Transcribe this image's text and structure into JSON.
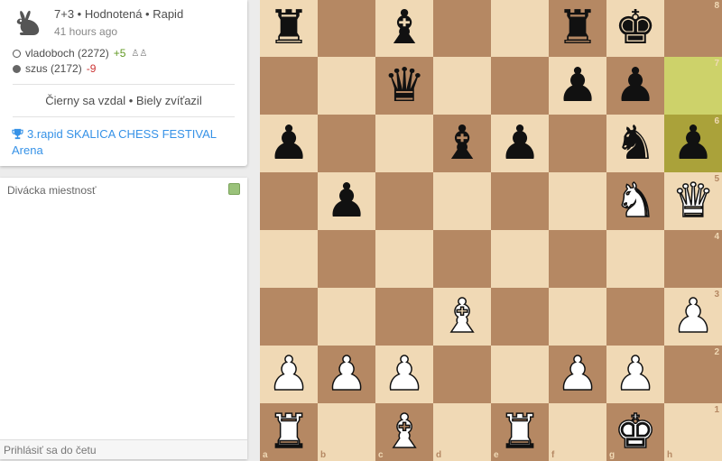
{
  "game": {
    "type": "7+3 • Hodnotená • Rapid",
    "time_ago": "41 hours ago",
    "icon": "rabbit-icon"
  },
  "players": [
    {
      "color": "white",
      "name": "vladoboch (2272)",
      "diff": "+5",
      "provisional_icon": "♙♙"
    },
    {
      "color": "black",
      "name": "szus (2172)",
      "diff": "-9"
    }
  ],
  "result": "Čierny sa vzdal • Biely zvíťazil",
  "tournament": {
    "label": "3.rapid SKALICA CHESS FESTIVAL Arena",
    "icon": "trophy-icon"
  },
  "chat": {
    "title": "Divácka miestnosť",
    "placeholder": "Prihlásiť sa do četu"
  },
  "colors": {
    "light": "#f0d9b5",
    "dark": "#b58863",
    "highlight_light": "#cdd26a",
    "highlight_dark": "#aaa23a",
    "link": "#3692e7"
  },
  "board": {
    "files": [
      "a",
      "b",
      "c",
      "d",
      "e",
      "f",
      "g",
      "h"
    ],
    "ranks": [
      "8",
      "7",
      "6",
      "5",
      "4",
      "3",
      "2",
      "1"
    ],
    "highlighted": [
      "h7",
      "h6"
    ],
    "pieces": [
      {
        "square": "a8",
        "piece": "b-rook"
      },
      {
        "square": "c8",
        "piece": "b-bishop"
      },
      {
        "square": "f8",
        "piece": "b-rook"
      },
      {
        "square": "g8",
        "piece": "b-king"
      },
      {
        "square": "c7",
        "piece": "b-queen"
      },
      {
        "square": "f7",
        "piece": "b-pawn"
      },
      {
        "square": "g7",
        "piece": "b-pawn"
      },
      {
        "square": "a6",
        "piece": "b-pawn"
      },
      {
        "square": "d6",
        "piece": "b-bishop"
      },
      {
        "square": "e6",
        "piece": "b-pawn"
      },
      {
        "square": "g6",
        "piece": "b-knight"
      },
      {
        "square": "h6",
        "piece": "b-pawn"
      },
      {
        "square": "b5",
        "piece": "b-pawn"
      },
      {
        "square": "g5",
        "piece": "w-knight"
      },
      {
        "square": "h5",
        "piece": "w-queen"
      },
      {
        "square": "d3",
        "piece": "w-bishop"
      },
      {
        "square": "h3",
        "piece": "w-pawn"
      },
      {
        "square": "a2",
        "piece": "w-pawn"
      },
      {
        "square": "b2",
        "piece": "w-pawn"
      },
      {
        "square": "c2",
        "piece": "w-pawn"
      },
      {
        "square": "f2",
        "piece": "w-pawn"
      },
      {
        "square": "g2",
        "piece": "w-pawn"
      },
      {
        "square": "a1",
        "piece": "w-rook"
      },
      {
        "square": "c1",
        "piece": "w-bishop"
      },
      {
        "square": "e1",
        "piece": "w-rook"
      },
      {
        "square": "g1",
        "piece": "w-king"
      }
    ]
  }
}
